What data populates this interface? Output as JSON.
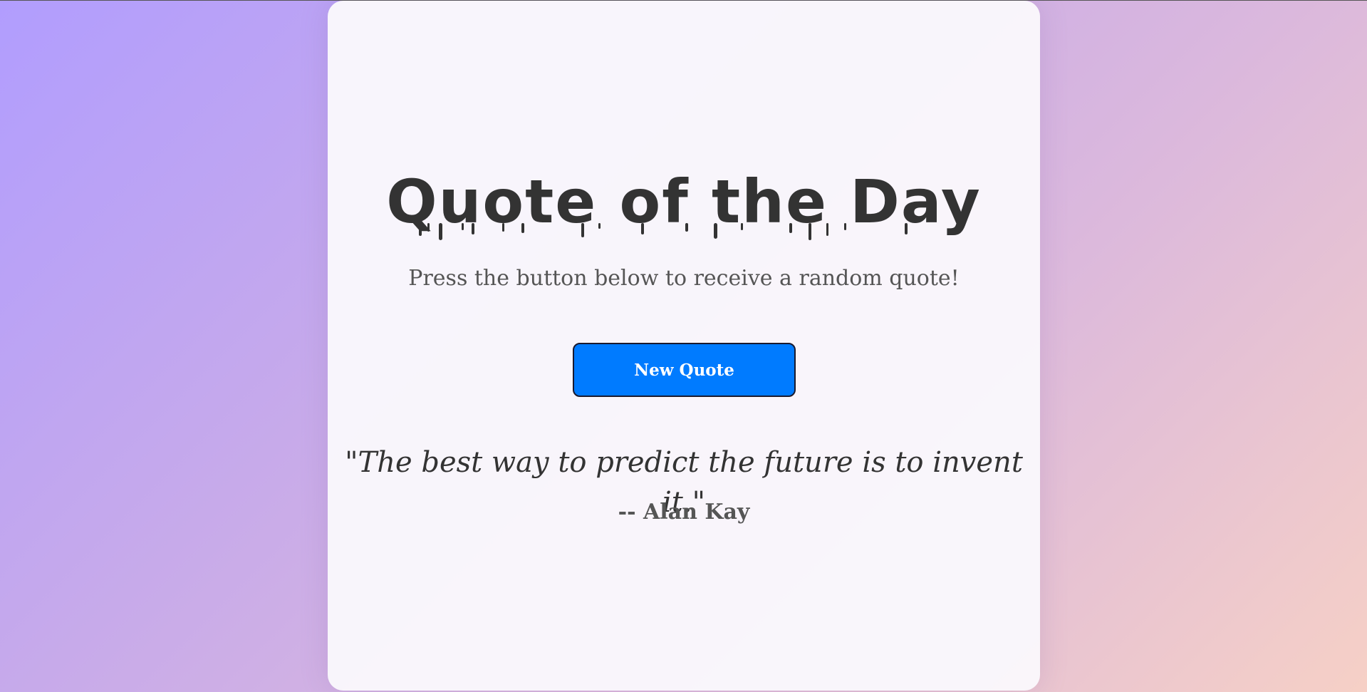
{
  "header": {
    "title": "Quote of the Day",
    "subtitle": "Press the button below to receive a random quote!"
  },
  "actions": {
    "new_quote_label": "New Quote"
  },
  "quote": {
    "text": "\"The best way to predict the future is to invent it.\"",
    "author": "-- Alan Kay"
  },
  "colors": {
    "button": "#007bff",
    "title": "#333333",
    "text_secondary": "#555555"
  }
}
